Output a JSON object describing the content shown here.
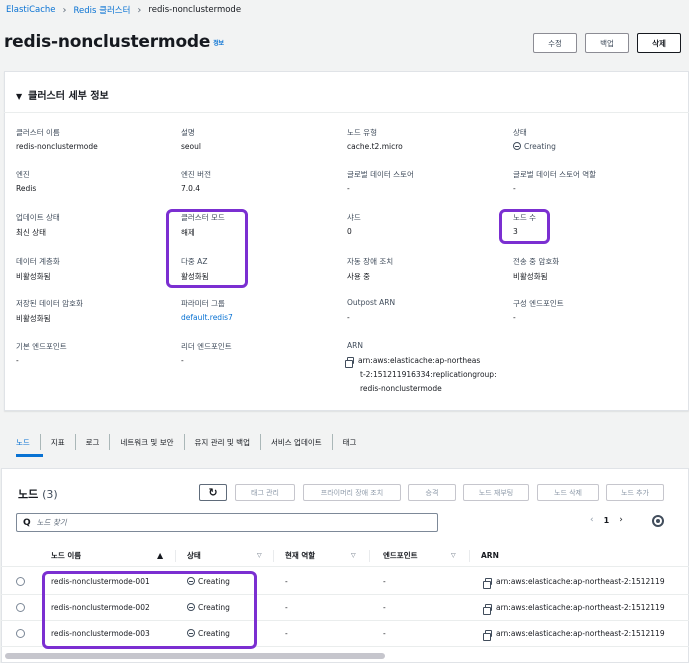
{
  "breadcrumb": {
    "items": [
      "ElastiCache",
      "Redis 클러스터",
      "redis-nonclustermode"
    ]
  },
  "header": {
    "title": "redis-nonclustermode",
    "info": "정보",
    "buttons": {
      "edit": "수정",
      "backup": "백업",
      "delete": "삭제"
    }
  },
  "details": {
    "heading": "클러스터 세부 정보",
    "fields": {
      "cluster_name": {
        "label": "클러스터 이름",
        "value": "redis-nonclustermode"
      },
      "description": {
        "label": "설명",
        "value": "seoul"
      },
      "node_type": {
        "label": "노드 유형",
        "value": "cache.t2.micro"
      },
      "status": {
        "label": "상태",
        "value": "Creating"
      },
      "engine": {
        "label": "엔진",
        "value": "Redis"
      },
      "engine_version": {
        "label": "엔진 버전",
        "value": "7.0.4"
      },
      "global_datastore": {
        "label": "글로벌 데이터 스토어",
        "value": "-"
      },
      "global_datastore_role": {
        "label": "글로벌 데이터 스토어 역할",
        "value": "-"
      },
      "update_status": {
        "label": "업데이트 상태",
        "value": "최신 상태"
      },
      "cluster_mode": {
        "label": "클러스터 모드",
        "value": "해제"
      },
      "shards": {
        "label": "샤드",
        "value": "0"
      },
      "node_count": {
        "label": "노드 수",
        "value": "3"
      },
      "data_tiering": {
        "label": "데이터 계층화",
        "value": "비활성화됨"
      },
      "multi_az": {
        "label": "다중 AZ",
        "value": "활성화됨"
      },
      "auto_failover": {
        "label": "자동 장애 조치",
        "value": "사용 중"
      },
      "transit_encryption": {
        "label": "전송 중 암호화",
        "value": "비활성화됨"
      },
      "at_rest_encryption": {
        "label": "저장된 데이터 암호화",
        "value": "비활성화됨"
      },
      "parameter_group": {
        "label": "파라미터 그룹",
        "value": "default.redis7"
      },
      "outpost_arn": {
        "label": "Outpost ARN",
        "value": "-"
      },
      "config_endpoint": {
        "label": "구성 엔드포인트",
        "value": "-"
      },
      "primary_endpoint": {
        "label": "기본 엔드포인트",
        "value": "-"
      },
      "reader_endpoint": {
        "label": "리더 엔드포인트",
        "value": "-"
      },
      "arn": {
        "label": "ARN",
        "lines": [
          "arn:aws:elasticache:ap-northeas",
          "t-2:151211916334:replicationgroup:",
          "redis-nonclustermode"
        ]
      }
    }
  },
  "tabs": [
    "노드",
    "지표",
    "로그",
    "네트워크 및 보안",
    "유지 관리 및 백업",
    "서비스 업데이트",
    "태그"
  ],
  "nodes": {
    "title": "노드",
    "count": "(3)",
    "buttons": {
      "tag_manage": "태그 관리",
      "primary_failover": "프라이머리 장애 조치",
      "promote": "승격",
      "reboot": "노드 재부팅",
      "delete": "노드 삭제",
      "add": "노드 추가"
    },
    "search_placeholder": "노드 찾기",
    "page": "1",
    "columns": [
      "노드 이름",
      "상태",
      "현재 역할",
      "엔드포인트",
      "ARN"
    ],
    "rows": [
      {
        "name": "redis-nonclustermode-001",
        "status": "Creating",
        "role": "-",
        "endpoint": "-",
        "arn": "arn:aws:elasticache:ap-northeast-2:1512119"
      },
      {
        "name": "redis-nonclustermode-002",
        "status": "Creating",
        "role": "-",
        "endpoint": "-",
        "arn": "arn:aws:elasticache:ap-northeast-2:1512119"
      },
      {
        "name": "redis-nonclustermode-003",
        "status": "Creating",
        "role": "-",
        "endpoint": "-",
        "arn": "arn:aws:elasticache:ap-northeast-2:1512119"
      }
    ]
  },
  "colors": {
    "link": "#0972d3",
    "highlight": "#7b2fd1",
    "text": "#16191f"
  }
}
